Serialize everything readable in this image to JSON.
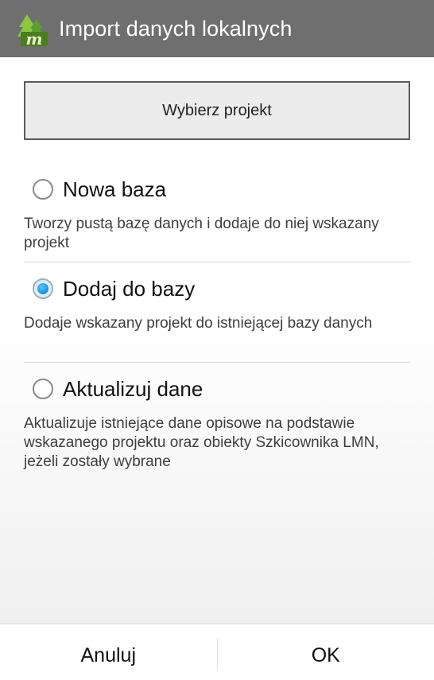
{
  "title": "Import danych lokalnych",
  "app_icon": "forest-m-logo-icon",
  "select_project_label": "Wybierz projekt",
  "options": [
    {
      "label": "Nowa baza",
      "description": "Tworzy pustą bazę danych i dodaje do niej wskazany projekt",
      "checked": false
    },
    {
      "label": "Dodaj do bazy",
      "description": "Dodaje wskazany projekt do istniejącej bazy danych",
      "checked": true
    },
    {
      "label": "Aktualizuj dane",
      "description": "Aktualizuje istniejące dane opisowe na podstawie wskazanego projektu oraz obiekty Szkicownika LMN, jeżeli zostały wybrane",
      "checked": false
    }
  ],
  "buttons": {
    "cancel": "Anuluj",
    "ok": "OK"
  },
  "colors": {
    "title_bar": "#6f6f6f",
    "radio_checked": "#1a98e8"
  }
}
